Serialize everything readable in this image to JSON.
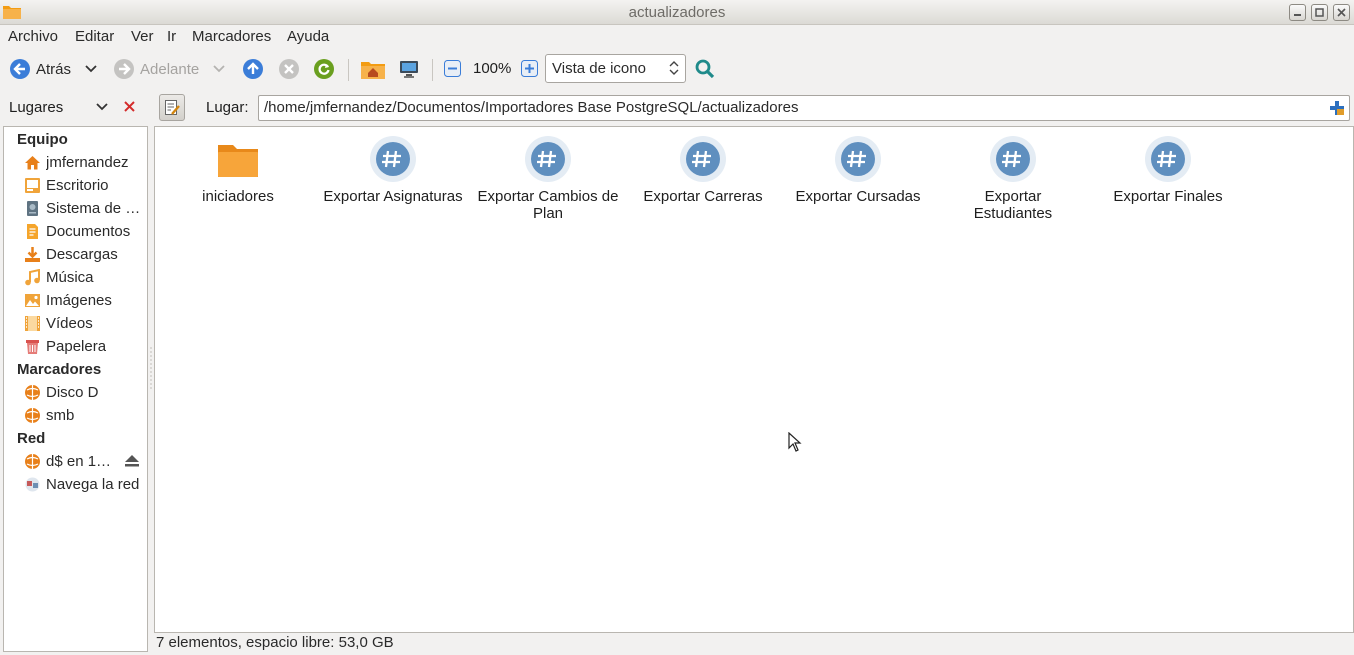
{
  "window": {
    "title": "actualizadores"
  },
  "menu": [
    "Archivo",
    "Editar",
    "Ver",
    "Ir",
    "Marcadores",
    "Ayuda"
  ],
  "toolbar": {
    "back_label": "Atrás",
    "forward_label": "Adelante",
    "zoom_level": "100%",
    "view_mode": "Vista de icono"
  },
  "location": {
    "places_label": "Lugares",
    "label": "Lugar:",
    "path": "/home/jmfernandez/Documentos/Importadores Base PostgreSQL/actualizadores"
  },
  "sidebar": {
    "sections": [
      {
        "heading": "Equipo",
        "items": [
          {
            "label": "jmfernandez",
            "icon": "home-icon"
          },
          {
            "label": "Escritorio",
            "icon": "desktop-icon"
          },
          {
            "label": "Sistema de …",
            "icon": "filesystem-icon"
          },
          {
            "label": "Documentos",
            "icon": "documents-icon"
          },
          {
            "label": "Descargas",
            "icon": "downloads-icon"
          },
          {
            "label": "Música",
            "icon": "music-icon"
          },
          {
            "label": "Imágenes",
            "icon": "pictures-icon"
          },
          {
            "label": "Vídeos",
            "icon": "videos-icon"
          },
          {
            "label": "Papelera",
            "icon": "trash-icon"
          }
        ]
      },
      {
        "heading": "Marcadores",
        "items": [
          {
            "label": "Disco D",
            "icon": "network-folder-icon"
          },
          {
            "label": "smb",
            "icon": "network-folder-icon"
          }
        ]
      },
      {
        "heading": "Red",
        "items": [
          {
            "label": "d$ en 1…",
            "icon": "network-folder-icon"
          },
          {
            "label": "Navega la red",
            "icon": "network-icon"
          }
        ]
      }
    ]
  },
  "files": [
    {
      "name": "iniciadores",
      "type": "folder"
    },
    {
      "name": "Exportar Asignaturas",
      "type": "script"
    },
    {
      "name": "Exportar Cambios de Plan",
      "type": "script"
    },
    {
      "name": "Exportar Carreras",
      "type": "script"
    },
    {
      "name": "Exportar Cursadas",
      "type": "script"
    },
    {
      "name": "Exportar Estudiantes",
      "type": "script"
    },
    {
      "name": "Exportar Finales",
      "type": "script"
    }
  ],
  "status": "7 elementos, espacio libre: 53,0 GB",
  "colors": {
    "accent": "#4a90d9",
    "folder": "#f5a623",
    "script_bg": "#d6e4f0",
    "script_fg": "#5b8fc4"
  }
}
